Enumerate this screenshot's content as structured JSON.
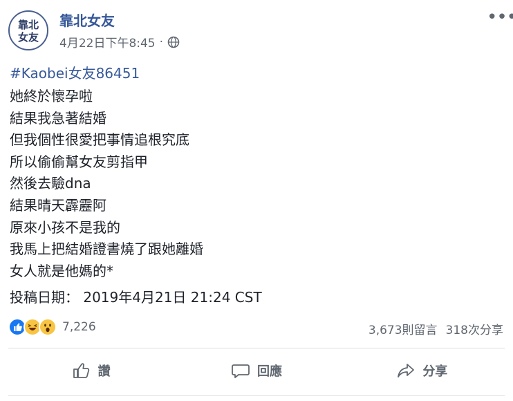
{
  "post": {
    "page_name": "靠北女友",
    "avatar_text": [
      "靠北",
      "女友"
    ],
    "timestamp": "4月22日下午8:45",
    "separator": "·",
    "more_label": "•••",
    "hashtag": "#Kaobei女友86451",
    "lines": [
      "她終於懷孕啦",
      "結果我急著結婚",
      "但我個性很愛把事情追根究底",
      "所以偷偷幫女友剪指甲",
      "然後去驗dna",
      "結果晴天霹靂阿",
      "原來小孩不是我的",
      "我馬上把結婚證書燒了跟她離婚",
      "女人就是他媽的*"
    ],
    "post_date": "投稿日期： 2019年4月21日 21:24 CST"
  },
  "reactions": {
    "icons": [
      "like-icon",
      "haha-icon",
      "wow-icon"
    ],
    "count": "7,226",
    "comments": "3,673則留言",
    "shares": "318次分享"
  },
  "actions": {
    "like_label": "讚",
    "comment_label": "回應",
    "share_label": "分享"
  },
  "colors": {
    "link": "#365899",
    "muted": "#606770",
    "like": "#1877f2",
    "emoji": "#f7c543"
  }
}
